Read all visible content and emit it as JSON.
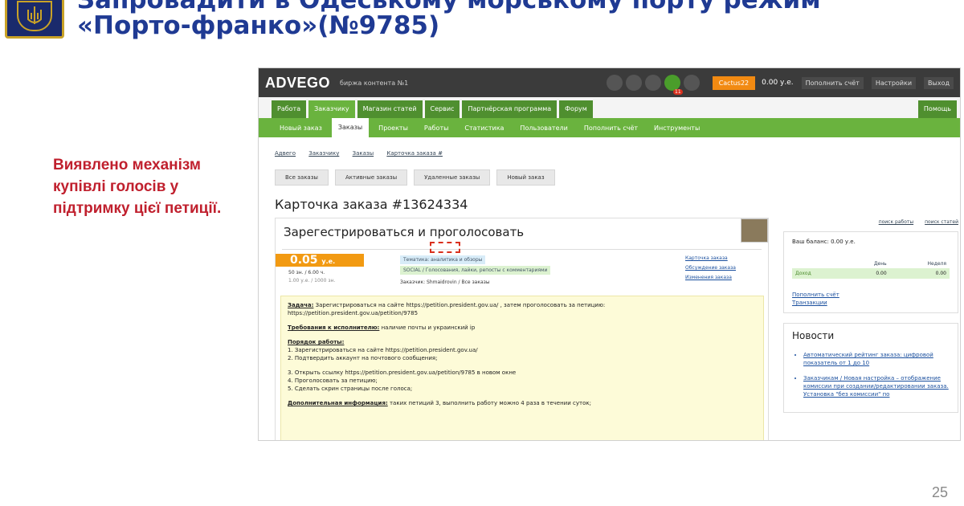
{
  "slide": {
    "title_line1": "Запровадити в Одеському морському порту режим",
    "title_line2": "«Порто-франко»(№9785)",
    "note": "Виявлено механізм купівлі голосів у підтримку цієї петиції.",
    "page_number": "25"
  },
  "colors": {
    "title": "#1f3a93",
    "note": "#c0202e",
    "green": "#6ab33e",
    "orange": "#f29a12",
    "topbar": "#3b3b3b"
  },
  "app": {
    "logo": "ADVEGO",
    "tagline": "биржа контента №1",
    "notification_count": "11",
    "user": "Cactus22",
    "balance": "0.00 у.е.",
    "deposit": "Пополнить счёт",
    "settings": "Настройки",
    "logout": "Выход"
  },
  "nav": [
    "Работа",
    "Заказчику",
    "Магазин статей",
    "Сервис",
    "Партнёрская программа",
    "Форум"
  ],
  "nav_active": "Заказчику",
  "help": "Помощь",
  "subnav": [
    "Новый заказ",
    "Заказы",
    "Проекты",
    "Работы",
    "Статистика",
    "Пользователи",
    "Пополнить счёт",
    "Инструменты"
  ],
  "breadcrumbs": [
    "Адвего",
    "Заказчику",
    "Заказы",
    "Карточка заказа #"
  ],
  "buttons": [
    "Все заказы",
    "Активные заказы",
    "Удаленные заказы",
    "Новый заказ"
  ],
  "card": {
    "heading": "Карточка заказа #13624334",
    "title": "Зарегестрироваться и проголосовать",
    "price": "0.05",
    "price_unit": "у.е.",
    "meta1": "50 зн. / 6.00 ч.",
    "meta2": "1.00 у.е. / 1000 зн.",
    "tag1": "Тематика: аналитика и обзоры",
    "tag2": "SOCIAL / Голосования, лайки, репосты с комментариями",
    "customer": "Заказчик: Shmaidrovin / Все заказы",
    "links": [
      "Карточка заказа",
      "Обсуждение заказа",
      "Изменения заказа"
    ]
  },
  "task": {
    "label_task": "Задача:",
    "task_text": "Зарегистрироваться на сайте https://petition.president.gov.ua/ , затем проголосовать за петицию:",
    "task_url": "https://petition.president.gov.ua/petition/9785",
    "label_req": "Требования к исполнителю:",
    "req_text": "наличие почты и украинский ip",
    "label_order": "Порядок работы:",
    "steps": [
      "1. Зарегистрироваться на сайте https://petition.president.gov.ua/",
      "2. Подтвердить аккаунт на почтового сообщения;",
      "3. Открыть ссылку https://petition.president.gov.ua/petition/9785 в новом окне",
      "4. Проголосовать за петицию;",
      "5. Сделать скрин страницы после голоса;"
    ],
    "label_extra": "Дополнительная информация:",
    "extra_text": "таких петиций 3, выполнить работу можно 4 раза в течении суток;"
  },
  "sidebar": {
    "top_links": [
      "поиск работы",
      "поиск статей"
    ],
    "balance_label": "Ваш баланс: 0.00 у.е.",
    "cols": [
      "День",
      "Неделя"
    ],
    "row_label": "Доход",
    "row_values": [
      "0.00",
      "0.00"
    ],
    "deposit_link": "Пополнить счёт",
    "transactions_link": "Транзакции",
    "news_title": "Новости",
    "news": [
      "Автоматический рейтинг заказа: цифровой показатель от 1 до 10",
      "Заказчикам / Новая настройка – отображение комиссии при создании/редактировании заказа. Установка \"без комиссии\" по"
    ]
  }
}
